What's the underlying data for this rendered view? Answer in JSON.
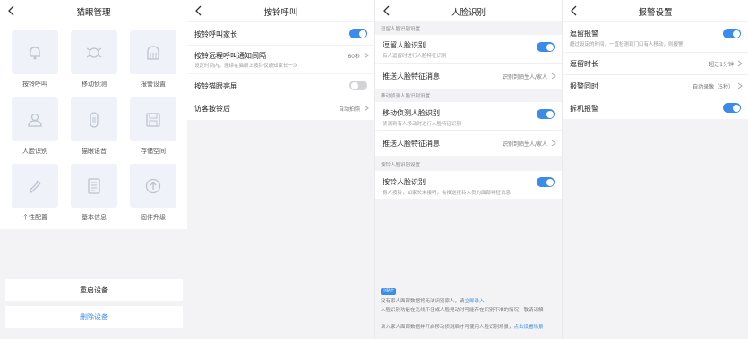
{
  "colors": {
    "accent": "#3b8bea",
    "toggle_off": "#d3d3d6"
  },
  "screen1": {
    "title": "猫眼管理",
    "grid": [
      {
        "label": "按铃呼叫",
        "icon": "bell-icon"
      },
      {
        "label": "移动侦测",
        "icon": "motion-icon"
      },
      {
        "label": "报警设置",
        "icon": "alarm-icon"
      },
      {
        "label": "人脸识别",
        "icon": "face-icon"
      },
      {
        "label": "猫眼语音",
        "icon": "voice-icon"
      },
      {
        "label": "存储空间",
        "icon": "storage-icon"
      },
      {
        "label": "个性配置",
        "icon": "config-icon"
      },
      {
        "label": "基本信息",
        "icon": "info-icon"
      },
      {
        "label": "固件升级",
        "icon": "upgrade-icon"
      }
    ],
    "restart": "重启设备",
    "delete": "删除设备"
  },
  "screen2": {
    "title": "按铃呼叫",
    "rows": [
      {
        "label": "按铃呼叫家长",
        "toggle": "on"
      },
      {
        "label": "按铃远程呼叫通知间隔",
        "sub": "设定时间内，连续在猫眼上按铃仅通知家长一次",
        "value": "60秒"
      },
      {
        "label": "按铃猫眼亮屏",
        "toggle": "off"
      },
      {
        "label": "访客按铃后",
        "value": "自动拍照"
      }
    ]
  },
  "screen3": {
    "title": "人脸识别",
    "section1": "逗留人脸识别设置",
    "stay_face": {
      "label": "逗留人脸识别",
      "sub": "有人逗留时进行人脸特征识别"
    },
    "push1": {
      "label": "推送人脸特征消息",
      "value": "识别到陌生人/家人"
    },
    "section2": "移动侦测人脸识别设置",
    "motion_face": {
      "label": "移动侦测人脸识别",
      "sub": "侦测到有人移动时进行人脸特征识别"
    },
    "push2": {
      "label": "推送人脸特征消息",
      "value": "识别到陌生人/家人"
    },
    "section3": "按铃人脸识别设置",
    "bell_face": {
      "label": "按铃人脸识别",
      "sub": "有人按铃，如家长未接听，会推送按铃人员的面部特征讯息"
    },
    "tag": "小贴士",
    "note1_text": "没有家人面部数据将无法识别家人，请",
    "note1_link": "立即录入",
    "note2": "人脸识别功能在光线不佳或人脸晃动时可能存在识别不准的情况，敬请谅解",
    "note3_text": "录入家人面部数据并开启移动侦测后才可使用人脸识别场景，",
    "note3_link": "点击设置场景"
  },
  "screen4": {
    "title": "报警设置",
    "stay_alarm": {
      "label": "逗留报警",
      "sub": "超过设定的时间，一直检测到门口有人移动，则报警"
    },
    "stay_time": {
      "label": "逗留时长",
      "value": "超过1分钟"
    },
    "alarm_together": {
      "label": "报警同时",
      "value": "自动录像（5秒）"
    },
    "tamper": {
      "label": "拆机报警"
    }
  }
}
